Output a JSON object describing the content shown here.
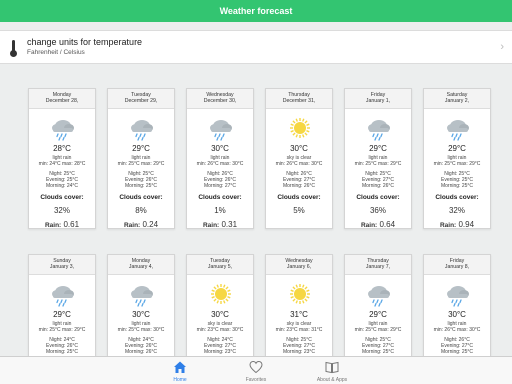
{
  "navbar": {
    "title": "Weather forecast"
  },
  "settings": {
    "title": "change units for temperature",
    "subtitle": "Fahrenheit / Celsius",
    "icon": "thermometer-icon"
  },
  "labels": {
    "clouds": "Clouds cover:",
    "rain": "Rain:"
  },
  "days": [
    {
      "dow": "Monday",
      "date": "December 28,",
      "icon": "cloud-rain",
      "temp": "28°C",
      "desc": "light rain",
      "minmax": "min: 24°C max: 28°C",
      "night": "Night: 25°C",
      "evening": "Evening: 25°C",
      "morning": "Morning: 24°C",
      "clouds": "32%",
      "rain": "0.61"
    },
    {
      "dow": "Tuesday",
      "date": "December 29,",
      "icon": "cloud-rain",
      "temp": "29°C",
      "desc": "light rain",
      "minmax": "min: 25°C max: 29°C",
      "night": "Night: 25°C",
      "evening": "Evening: 26°C",
      "morning": "Morning: 25°C",
      "clouds": "8%",
      "rain": "0.24"
    },
    {
      "dow": "Wednesday",
      "date": "December 30,",
      "icon": "cloud-rain",
      "temp": "30°C",
      "desc": "light rain",
      "minmax": "min: 26°C max: 30°C",
      "night": "Night: 26°C",
      "evening": "Evening: 26°C",
      "morning": "Morning: 27°C",
      "clouds": "1%",
      "rain": "0.31"
    },
    {
      "dow": "Thursday",
      "date": "December 31,",
      "icon": "sun",
      "temp": "30°C",
      "desc": "sky is clear",
      "minmax": "min: 26°C max: 30°C",
      "night": "Night: 26°C",
      "evening": "Evening: 27°C",
      "morning": "Morning: 26°C",
      "clouds": "5%",
      "rain": ""
    },
    {
      "dow": "Friday",
      "date": "January 1,",
      "icon": "cloud-rain",
      "temp": "29°C",
      "desc": "light rain",
      "minmax": "min: 25°C max: 29°C",
      "night": "Night: 25°C",
      "evening": "Evening: 27°C",
      "morning": "Morning: 26°C",
      "clouds": "36%",
      "rain": "0.64"
    },
    {
      "dow": "Saturday",
      "date": "January 2,",
      "icon": "cloud-rain",
      "temp": "29°C",
      "desc": "light rain",
      "minmax": "min: 25°C max: 29°C",
      "night": "Night: 25°C",
      "evening": "Evening: 25°C",
      "morning": "Morning: 25°C",
      "clouds": "32%",
      "rain": "0.94"
    },
    {
      "dow": "Sunday",
      "date": "January 3,",
      "icon": "cloud-rain",
      "temp": "29°C",
      "desc": "light rain",
      "minmax": "min: 25°C max: 29°C",
      "night": "Night: 24°C",
      "evening": "Evening: 26°C",
      "morning": "Morning: 25°C",
      "clouds": "",
      "rain": ""
    },
    {
      "dow": "Monday",
      "date": "January 4,",
      "icon": "cloud-rain",
      "temp": "30°C",
      "desc": "light rain",
      "minmax": "min: 25°C max: 30°C",
      "night": "Night: 24°C",
      "evening": "Evening: 26°C",
      "morning": "Morning: 26°C",
      "clouds": "",
      "rain": ""
    },
    {
      "dow": "Tuesday",
      "date": "January 5,",
      "icon": "sun",
      "temp": "30°C",
      "desc": "sky is clear",
      "minmax": "min: 23°C max: 30°C",
      "night": "Night: 24°C",
      "evening": "Evening: 27°C",
      "morning": "Morning: 23°C",
      "clouds": "",
      "rain": ""
    },
    {
      "dow": "Wednesday",
      "date": "January 6,",
      "icon": "sun",
      "temp": "31°C",
      "desc": "sky is clear",
      "minmax": "min: 23°C max: 31°C",
      "night": "Night: 25°C",
      "evening": "Evening: 27°C",
      "morning": "Morning: 23°C",
      "clouds": "",
      "rain": ""
    },
    {
      "dow": "Thursday",
      "date": "January 7,",
      "icon": "cloud-rain",
      "temp": "29°C",
      "desc": "light rain",
      "minmax": "min: 25°C max: 29°C",
      "night": "Night: 25°C",
      "evening": "Evening: 27°C",
      "morning": "Morning: 25°C",
      "clouds": "",
      "rain": ""
    },
    {
      "dow": "Friday",
      "date": "January 8,",
      "icon": "cloud-rain",
      "temp": "30°C",
      "desc": "light rain",
      "minmax": "min: 26°C max: 30°C",
      "night": "Night: 26°C",
      "evening": "Evening: 27°C",
      "morning": "Morning: 25°C",
      "clouds": "",
      "rain": ""
    }
  ],
  "tabs": [
    {
      "label": "Home",
      "icon": "home-icon",
      "active": true
    },
    {
      "label": "Favorites",
      "icon": "heart-icon",
      "active": false
    },
    {
      "label": "About & Apps",
      "icon": "book-icon",
      "active": false
    }
  ],
  "colors": {
    "accent": "#33c571",
    "tab_active": "#2f7fe8",
    "sun": "#f6d743",
    "cloud": "#b7c0c6",
    "rain": "#5aa7e6"
  }
}
